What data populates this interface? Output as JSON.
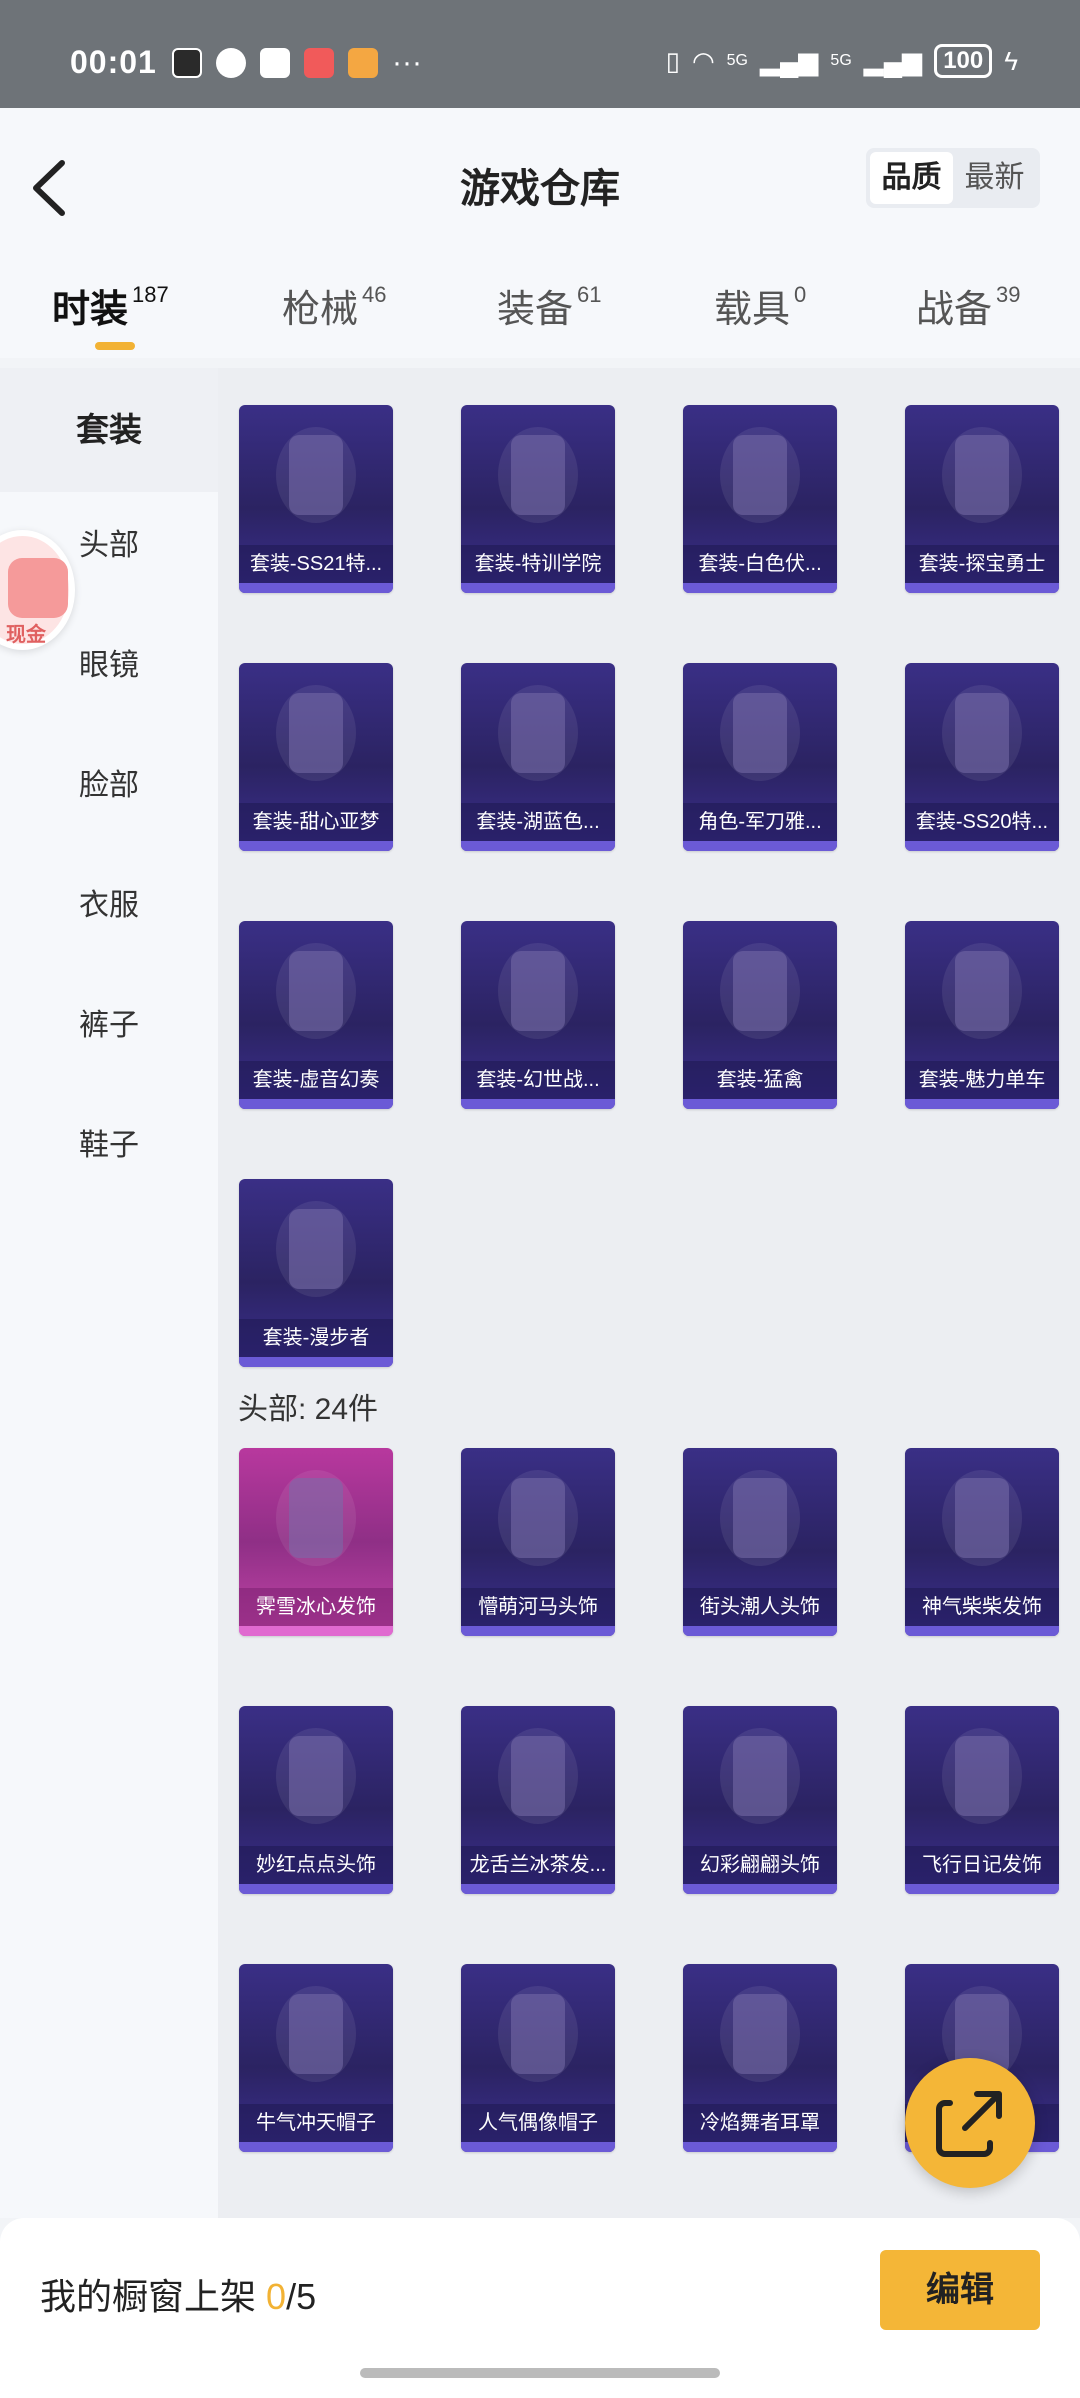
{
  "status_bar": {
    "time": "00:01",
    "signal1": "5G",
    "signal2": "5G",
    "battery": "100"
  },
  "header": {
    "title": "游戏仓库",
    "sort_options": [
      "品质",
      "最新"
    ],
    "active_sort": "品质"
  },
  "tabs": [
    {
      "label": "时装",
      "count": "187",
      "active": true
    },
    {
      "label": "枪械",
      "count": "46"
    },
    {
      "label": "装备",
      "count": "61"
    },
    {
      "label": "载具",
      "count": "0"
    },
    {
      "label": "战备",
      "count": "39"
    }
  ],
  "sidebar": {
    "items": [
      "套装",
      "头部",
      "眼镜",
      "脸部",
      "衣服",
      "裤子",
      "鞋子"
    ],
    "active": "套装",
    "badge_caption": "现金"
  },
  "sections": [
    {
      "title": "",
      "items": [
        "套装-SS21特...",
        "套装-特训学院",
        "套装-白色伏...",
        "套装-探宝勇士",
        "套装-甜心亚梦",
        "套装-湖蓝色...",
        "角色-军刀雅...",
        "套装-SS20特...",
        "套装-虚音幻奏",
        "套装-幻世战...",
        "套装-猛禽",
        "套装-魅力单车",
        "套装-漫步者"
      ]
    },
    {
      "title": "头部: 24件",
      "items": [
        "霁雪冰心发饰",
        "懵萌河马头饰",
        "街头潮人头饰",
        "神气柴柴发饰",
        "妙红点点头饰",
        "龙舌兰冰茶发...",
        "幻彩翩翩头饰",
        "飞行日记发饰",
        "牛气冲天帽子",
        "人气偶像帽子",
        "冷焰舞者耳罩",
        ""
      ]
    }
  ],
  "bottom": {
    "showcase_label": "我的橱窗上架",
    "showcase_count": "0",
    "showcase_total": "/5",
    "edit_label": "编辑"
  },
  "colors": {
    "accent": "#f4b637",
    "card_purple": "#2b2362",
    "card_pink": "#b8389e"
  }
}
